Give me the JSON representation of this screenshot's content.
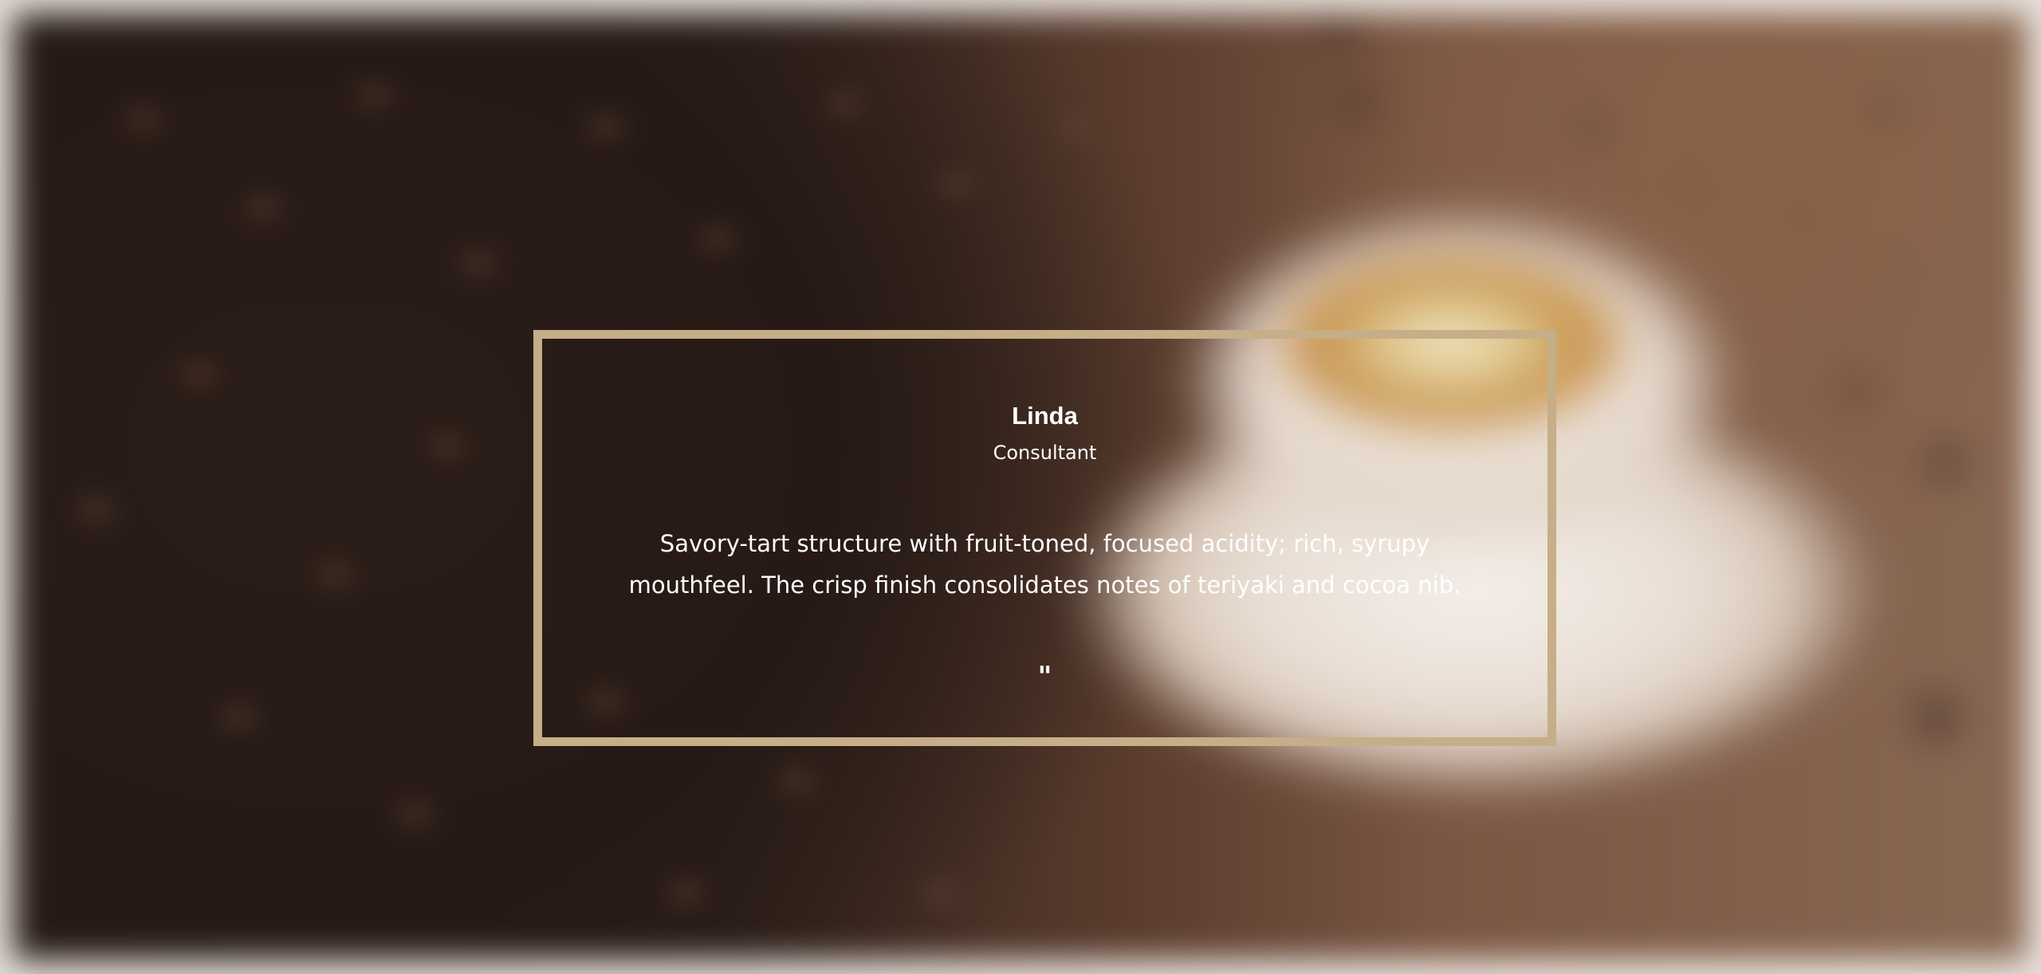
{
  "testimonial": {
    "name": "Linda",
    "role": "Consultant",
    "quote": "Savory-tart structure with fruit-toned, focused acidity; rich, syrupy mouthfeel. The crisp finish consolidates notes of teriyaki and cocoa nib.",
    "quote_mark": "\""
  },
  "colors": {
    "card_border": "#c5ae88",
    "text": "#ffffff",
    "background_dark": "#271a16"
  },
  "icons": {
    "quote_mark": "quote-icon"
  }
}
